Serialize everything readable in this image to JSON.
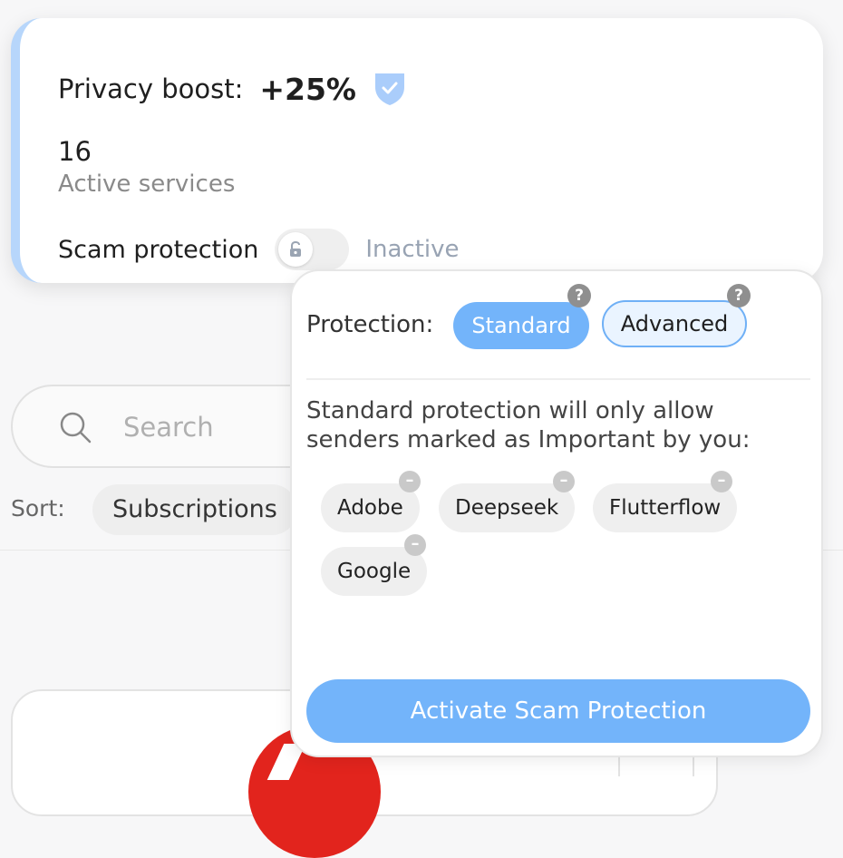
{
  "summary": {
    "privacy_boost_label": "Privacy boost:",
    "privacy_boost_value": "+25%",
    "active_services_count": "16",
    "active_services_label": "Active services",
    "scam_protection_label": "Scam protection",
    "scam_protection_status": "Inactive"
  },
  "search": {
    "placeholder": "Search"
  },
  "sort": {
    "label": "Sort:",
    "value": "Subscriptions"
  },
  "popup": {
    "protection_label": "Protection:",
    "options": [
      {
        "label": "Standard",
        "selected": true
      },
      {
        "label": "Advanced",
        "selected": false
      }
    ],
    "description": "Standard protection will only allow senders marked as Important by you:",
    "senders": [
      "Adobe",
      "Deepseek",
      "Flutterflow",
      "Google"
    ],
    "activate_label": "Activate Scam Protection",
    "help_symbol": "?",
    "remove_symbol": "–"
  },
  "colors": {
    "accent": "#73b4fa",
    "card_border": "#b7d6fb",
    "inactive_text": "#98a3b3"
  }
}
